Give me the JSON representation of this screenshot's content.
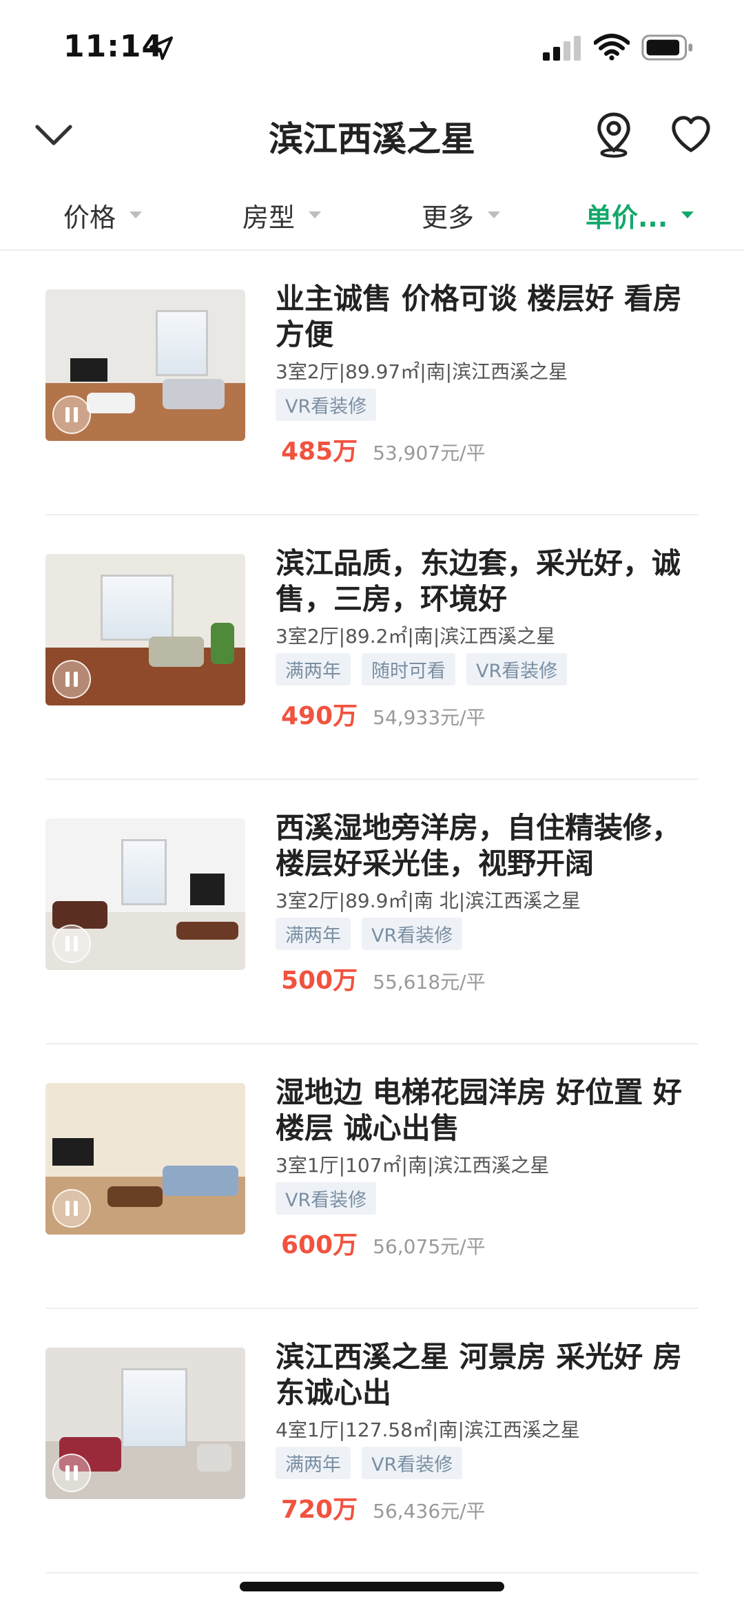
{
  "status_bar": {
    "time": "11:14"
  },
  "nav": {
    "title": "滨江西溪之星"
  },
  "filters": [
    {
      "label": "价格",
      "active": false
    },
    {
      "label": "房型",
      "active": false
    },
    {
      "label": "更多",
      "active": false
    },
    {
      "label": "单价...",
      "active": true
    }
  ],
  "accent_color": "#13a86b",
  "price_color": "#f0533f",
  "listings": [
    {
      "title": "业主诚售 价格可谈 楼层好 看房方便",
      "spec": "3室2厅|89.97㎡|南|滨江西溪之星",
      "tags": [
        "VR看装修"
      ],
      "price": "485万",
      "unit_price": "53,907元/平"
    },
    {
      "title": "滨江品质，东边套，采光好，诚售，三房，环境好",
      "spec": "3室2厅|89.2㎡|南|滨江西溪之星",
      "tags": [
        "满两年",
        "随时可看",
        "VR看装修"
      ],
      "price": "490万",
      "unit_price": "54,933元/平"
    },
    {
      "title": "西溪湿地旁洋房，自住精装修，楼层好采光佳，视野开阔",
      "spec": "3室2厅|89.9㎡|南 北|滨江西溪之星",
      "tags": [
        "满两年",
        "VR看装修"
      ],
      "price": "500万",
      "unit_price": "55,618元/平"
    },
    {
      "title": "湿地边 电梯花园洋房 好位置 好楼层 诚心出售",
      "spec": "3室1厅|107㎡|南|滨江西溪之星",
      "tags": [
        "VR看装修"
      ],
      "price": "600万",
      "unit_price": "56,075元/平"
    },
    {
      "title": "滨江西溪之星 河景房 采光好 房东诚心出",
      "spec": "4室1厅|127.58㎡|南|滨江西溪之星",
      "tags": [
        "满两年",
        "VR看装修"
      ],
      "price": "720万",
      "unit_price": "56,436元/平"
    }
  ]
}
